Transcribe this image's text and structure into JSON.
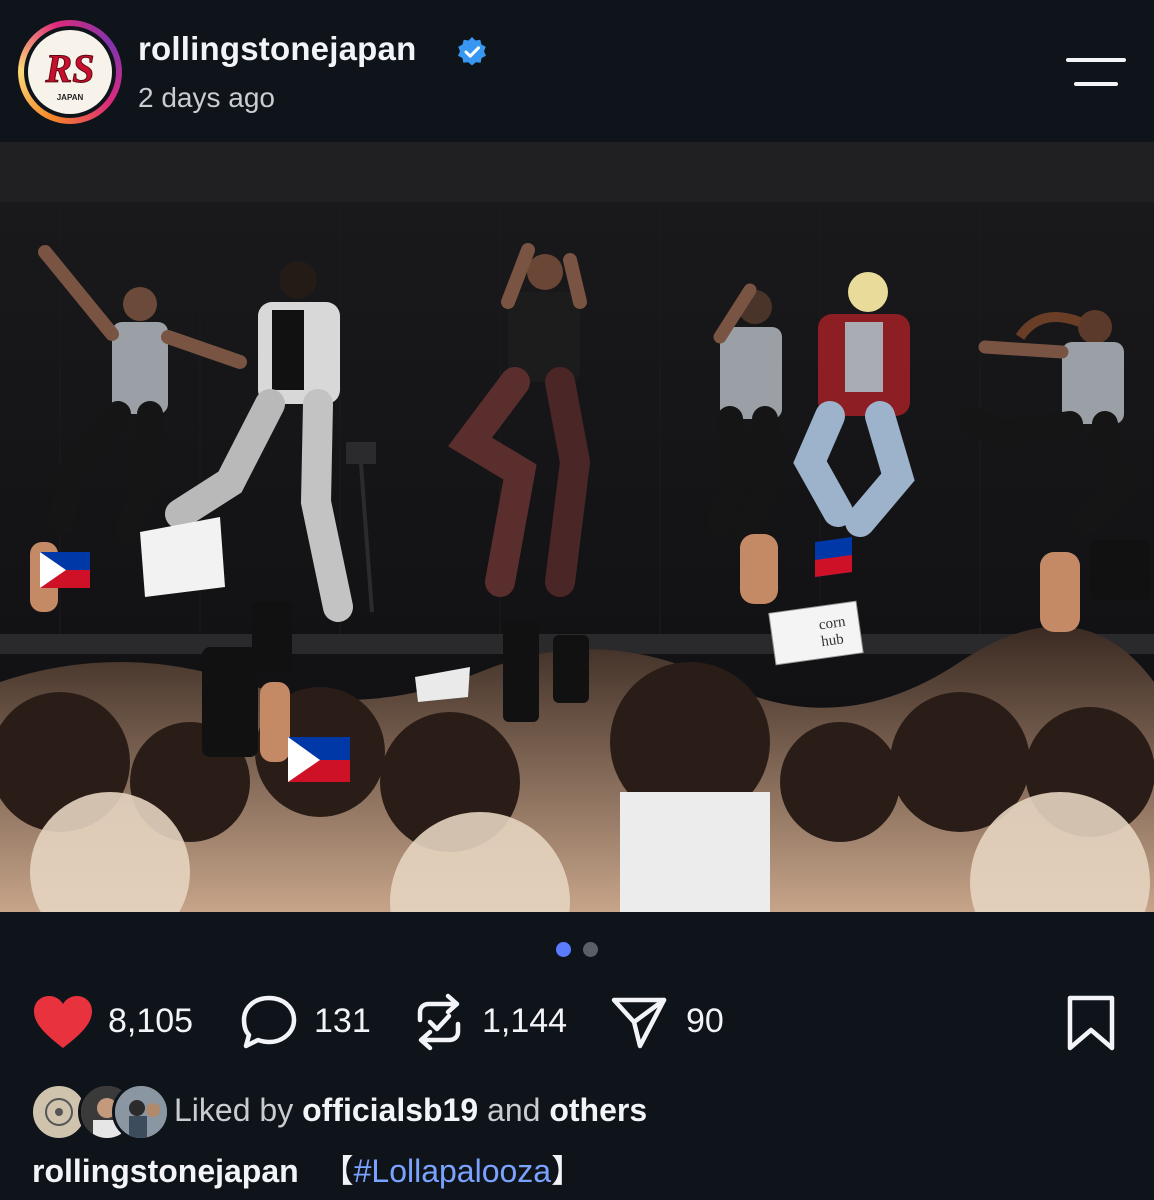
{
  "post": {
    "username": "rollingstonejapan",
    "time": "2 days ago",
    "avatar_logo_text": "RS",
    "avatar_logo_sub": "JAPAN",
    "verified_icon": "verified-badge-icon",
    "menu_icon": "menu-icon"
  },
  "photo": {
    "sign_line1": "corn",
    "sign_line2": "hub"
  },
  "carousel": {
    "active_index": 0,
    "count": 2,
    "active_color": "#5b7cff",
    "inactive_color": "#5a5f66"
  },
  "actions": {
    "likes": "8,105",
    "comments": "131",
    "reposts": "1,144",
    "shares": "90",
    "like_color": "#e8333e"
  },
  "liked_by": {
    "prefix": "Liked by ",
    "user": "officialsb19",
    "middle": " and ",
    "suffix": "others"
  },
  "caption": {
    "username": "rollingstonejapan",
    "open_bracket": "【",
    "hashtag": "#Lollapalooza",
    "close_bracket": "】"
  }
}
